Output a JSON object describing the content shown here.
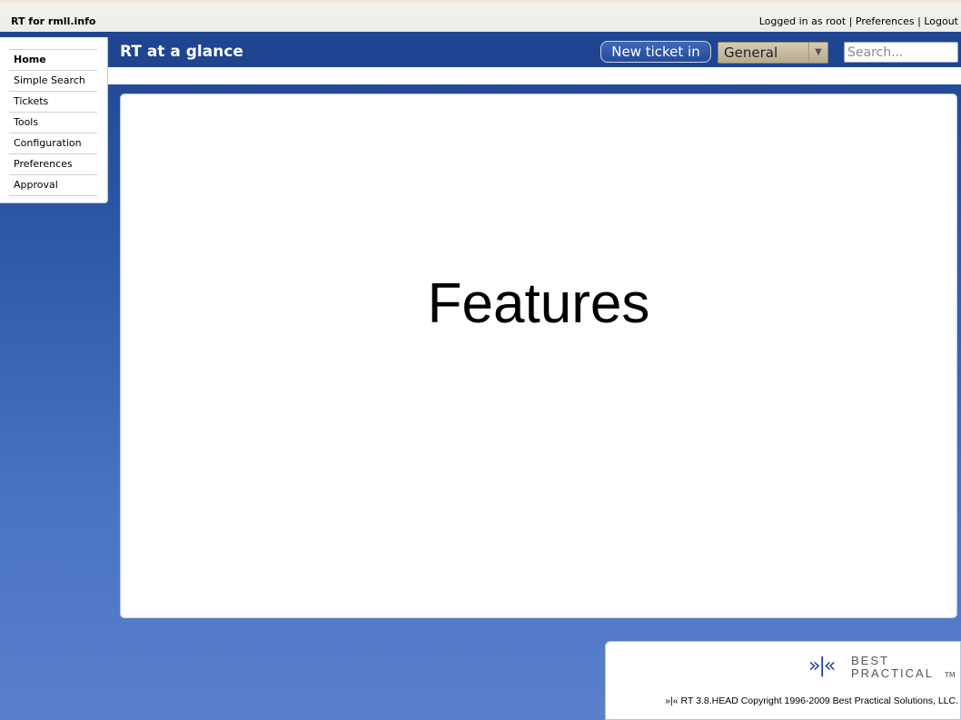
{
  "topbar": {
    "site_title": "RT for rmll.info",
    "logged_in_text": "Logged in as root",
    "separator": "|",
    "preferences_link": "Preferences",
    "logout_link": "Logout"
  },
  "header": {
    "page_title": "RT at a glance",
    "new_ticket_label": "New ticket in",
    "queue_selected": "General",
    "search_placeholder": "Search..."
  },
  "sidebar": {
    "items": [
      {
        "label": "Home",
        "active": true
      },
      {
        "label": "Simple Search"
      },
      {
        "label": "Tickets"
      },
      {
        "label": "Tools"
      },
      {
        "label": "Configuration"
      },
      {
        "label": "Preferences"
      },
      {
        "label": "Approval"
      }
    ]
  },
  "main": {
    "overlay_text": "Features"
  },
  "footer": {
    "logo_mark": "»|«",
    "logo_line1": "BEST",
    "logo_line2": "PRACTICAL",
    "logo_tm": "TM",
    "copyright": "»|« RT 3.8.HEAD Copyright 1996-2009 Best Practical Solutions, LLC."
  },
  "colors": {
    "header_blue": "#1f4591",
    "background_gradient_end": "#5a80cc"
  }
}
